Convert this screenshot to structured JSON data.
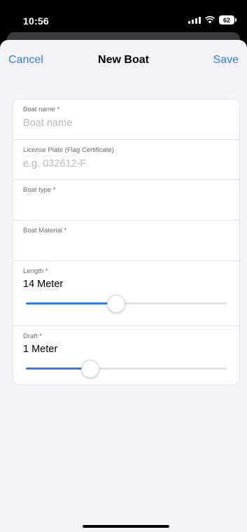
{
  "status": {
    "time": "10:56",
    "battery": "62"
  },
  "nav": {
    "cancel": "Cancel",
    "title": "New Boat",
    "save": "Save"
  },
  "form": {
    "boat_name": {
      "label": "Boat name *",
      "placeholder": "Boat name",
      "value": ""
    },
    "license_plate": {
      "label": "License Plate (Flag Certificate)",
      "placeholder": "e.g. 032612-F",
      "value": ""
    },
    "boat_type": {
      "label": "Boat type *",
      "value": ""
    },
    "boat_material": {
      "label": "Boat Material *",
      "value": ""
    },
    "length": {
      "label": "Length *",
      "value": "14 Meter",
      "slider_fraction": 0.45
    },
    "draft": {
      "label": "Draft *",
      "value": "1 Meter",
      "slider_fraction": 0.32
    }
  },
  "colors": {
    "accent": "#2f7cf6",
    "slider_fill": "#3478f6",
    "sheet_bg": "#f2f2f7"
  },
  "icons": [
    "signal-icon",
    "wifi-icon",
    "battery-icon"
  ]
}
